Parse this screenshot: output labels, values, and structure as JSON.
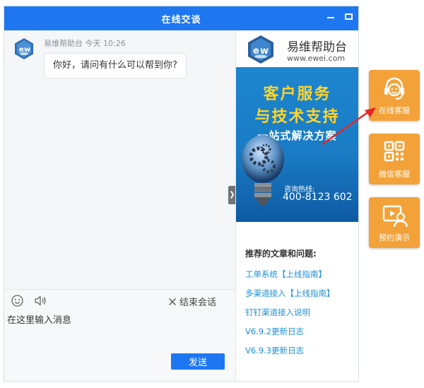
{
  "window": {
    "title": "在线交谈"
  },
  "chat": {
    "sender": "易维帮助台",
    "time": "今天 10:26",
    "message": "你好，请问有什么可以帮到你?"
  },
  "toolbar": {
    "end_session": "结束会话"
  },
  "input": {
    "placeholder": "在这里输入消息",
    "send_label": "发送"
  },
  "side": {
    "brand_name": "易维帮助台",
    "brand_url": "www.ewei.com",
    "banner": {
      "line1": "客户服务",
      "line2": "与技术支持",
      "line3": "一站式解决方案",
      "hotline_label": "咨询热线:",
      "hotline_number": "400-8123 602"
    },
    "recommend_title": "推荐的文章和问题:",
    "links": [
      "工单系统【上线指南】",
      "多渠道接入【上线指南】",
      "钉钉渠道接入说明",
      "V6.9.2更新日志",
      "V6.9.3更新日志"
    ]
  },
  "float_buttons": [
    {
      "label": "在线客服",
      "icon": "headset-icon"
    },
    {
      "label": "微信客服",
      "icon": "qr-code-icon"
    },
    {
      "label": "预约演示",
      "icon": "video-user-icon"
    }
  ],
  "colors": {
    "primary": "#1e77f1",
    "float_orange": "#f3a23a",
    "link": "#1d8fd6",
    "banner_yellow": "#ffd42a",
    "arrow": "#e32727"
  }
}
